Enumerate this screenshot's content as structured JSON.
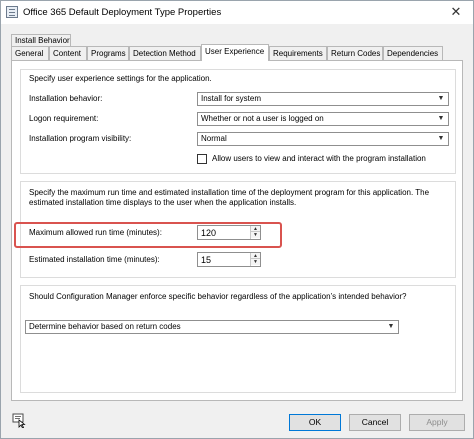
{
  "window": {
    "title": "Office 365 Default Deployment Type Properties",
    "close_glyph": "✕",
    "icon": "properties-window-icon"
  },
  "tabs_top": [
    {
      "label": "Install Behavior"
    }
  ],
  "tabs_bottom": [
    {
      "label": "General"
    },
    {
      "label": "Content"
    },
    {
      "label": "Programs"
    },
    {
      "label": "Detection Method"
    },
    {
      "label": "User Experience",
      "active": true
    },
    {
      "label": "Requirements"
    },
    {
      "label": "Return Codes"
    },
    {
      "label": "Dependencies"
    }
  ],
  "user_experience": {
    "intro": "Specify user experience settings for the application.",
    "installation_behavior": {
      "label": "Installation behavior:",
      "value": "Install for system"
    },
    "logon_requirement": {
      "label": "Logon requirement:",
      "value": "Whether or not a user is logged on"
    },
    "program_visibility": {
      "label": "Installation program visibility:",
      "value": "Normal"
    },
    "allow_interact": {
      "label": "Allow users to view and interact with the program installation",
      "checked": false
    }
  },
  "run_time": {
    "description": "Specify the maximum run time and estimated installation time of the deployment program for this application. The estimated installation time displays to the user when the application installs.",
    "max_run_time": {
      "label": "Maximum allowed run time (minutes):",
      "value": "120"
    },
    "estimated_time": {
      "label": "Estimated installation time (minutes):",
      "value": "15"
    }
  },
  "enforce": {
    "question": "Should Configuration Manager enforce specific behavior regardless of the application’s intended behavior?",
    "value": "Determine behavior based on return codes"
  },
  "buttons": {
    "ok": "OK",
    "cancel": "Cancel",
    "apply": "Apply"
  },
  "colors": {
    "highlight": "#d9534f",
    "accent": "#0078d7"
  }
}
